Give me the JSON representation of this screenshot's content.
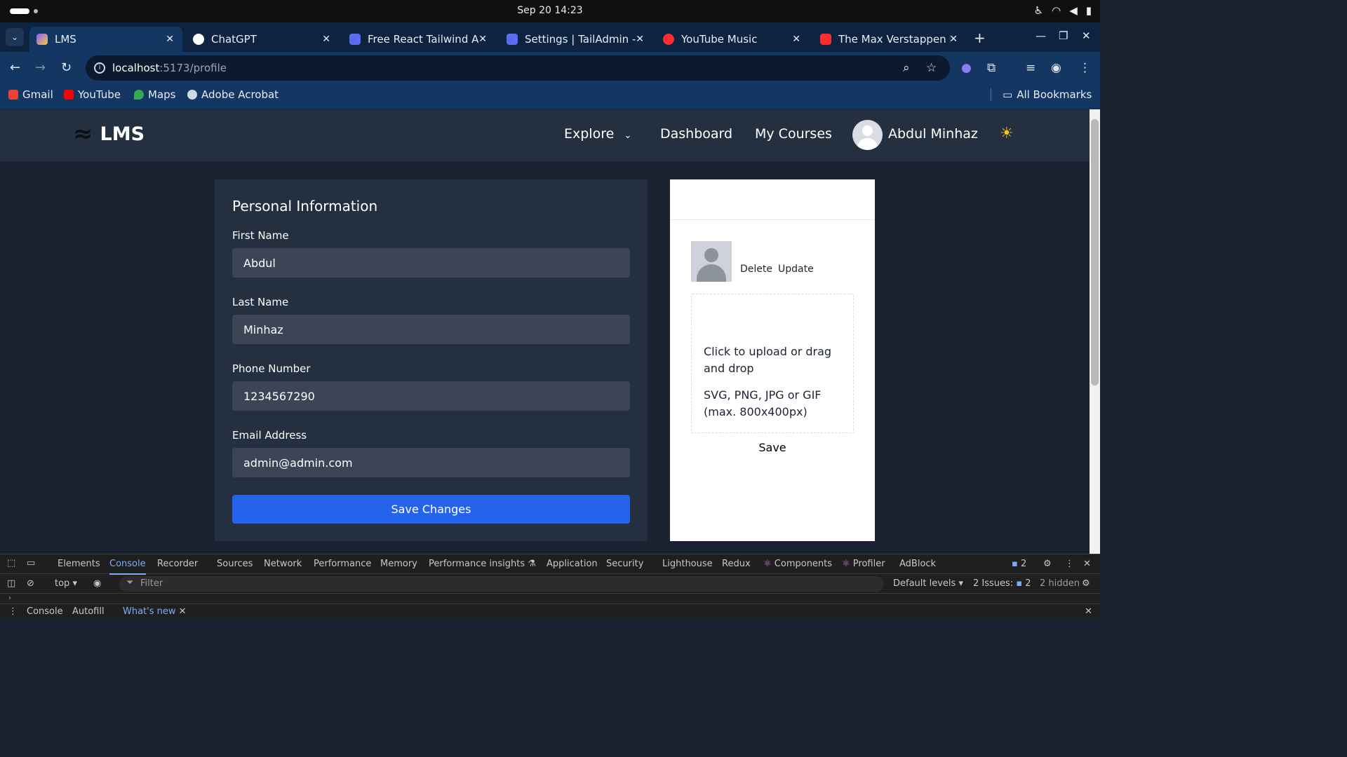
{
  "os": {
    "clock": "Sep 20  14:23"
  },
  "browser": {
    "tabs": [
      {
        "label": "LMS",
        "color": "#f2c94c"
      },
      {
        "label": "ChatGPT",
        "color": "#ffffff"
      },
      {
        "label": "Free React Tailwind A",
        "color": "#5b6cf0"
      },
      {
        "label": "Settings | TailAdmin -",
        "color": "#5b6cf0"
      },
      {
        "label": "YouTube Music",
        "color": "#ff2d2d"
      },
      {
        "label": "The Max Verstappen F",
        "color": "#ff2d2d"
      }
    ],
    "url_host": "localhost",
    "url_path": ":5173/profile",
    "bookmarks": [
      {
        "label": "Gmail",
        "color": "#ea4335"
      },
      {
        "label": "YouTube",
        "color": "#ff0000"
      },
      {
        "label": "Maps",
        "color": "#34a853"
      },
      {
        "label": "Adobe Acrobat",
        "color": "#cfd8e4"
      }
    ],
    "all_bookmarks": "All Bookmarks"
  },
  "app": {
    "logo": "LMS",
    "nav": {
      "explore": "Explore",
      "dashboard": "Dashboard",
      "my_courses": "My Courses",
      "user_name": "Abdul Minhaz"
    },
    "personal_info": {
      "title": "Personal Information",
      "first_name_label": "First Name",
      "first_name": "Abdul",
      "last_name_label": "Last Name",
      "last_name": "Minhaz",
      "phone_label": "Phone Number",
      "phone": "1234567290",
      "email_label": "Email Address",
      "email": "admin@admin.com",
      "save": "Save Changes"
    },
    "photo": {
      "delete": "Delete",
      "update": "Update",
      "upload_text": "Click to upload or drag and drop",
      "formats": "SVG, PNG, JPG or GIF (max. 800x400px)",
      "save": "Save"
    }
  },
  "devtools": {
    "tabs": [
      "Elements",
      "Console",
      "Recorder",
      "Sources",
      "Network",
      "Performance",
      "Memory",
      "Performance insights",
      "Application",
      "Security",
      "Lighthouse",
      "Redux",
      "Components",
      "Profiler",
      "AdBlock"
    ],
    "active_tab": "Console",
    "issue_count": "2",
    "context": "top",
    "filter_placeholder": "Filter",
    "levels": "Default levels",
    "issues": "2 Issues:",
    "issues_count": "2",
    "hidden": "2 hidden",
    "drawer_tabs": [
      "Console",
      "Autofill",
      "What's new"
    ]
  }
}
